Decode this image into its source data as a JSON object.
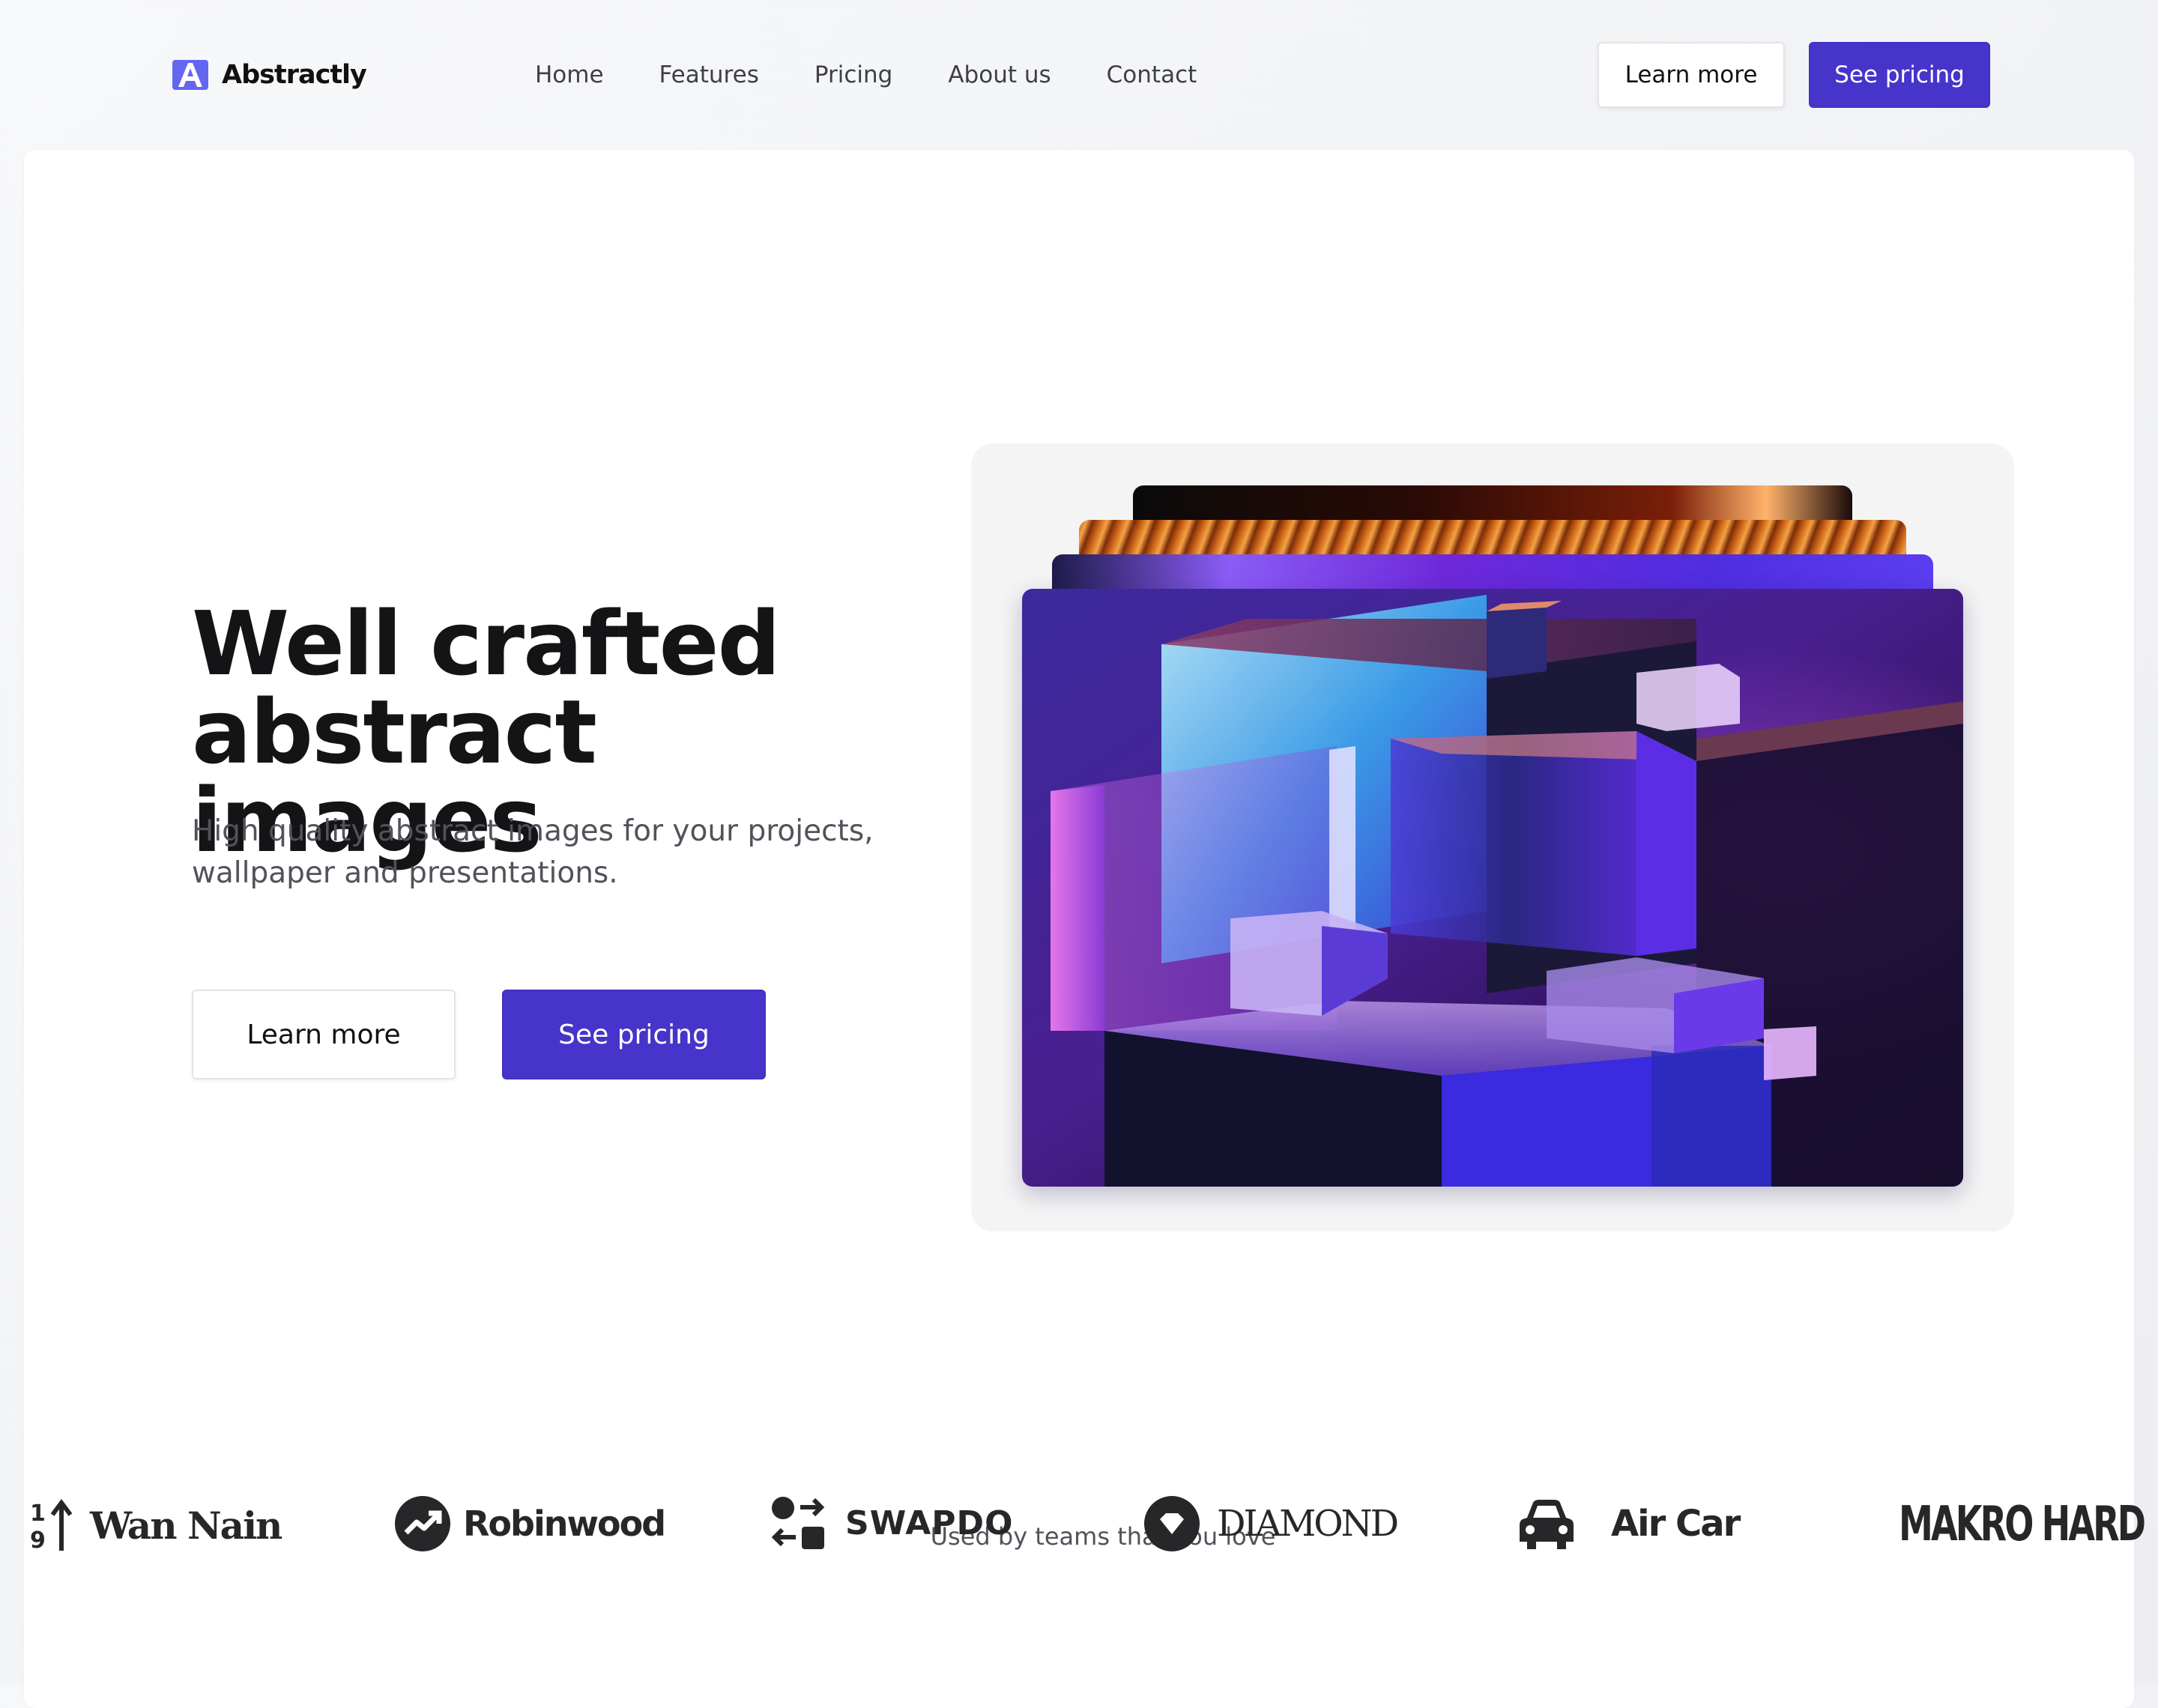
{
  "brand": {
    "name": "Abstractly",
    "color": "#6366f1"
  },
  "nav": {
    "items": [
      {
        "label": "Home"
      },
      {
        "label": "Features"
      },
      {
        "label": "Pricing"
      },
      {
        "label": "About us"
      },
      {
        "label": "Contact"
      }
    ]
  },
  "header": {
    "learn_label": "Learn more",
    "pricing_label": "See pricing"
  },
  "hero": {
    "title_line1": "Well crafted",
    "title_line2": "abstract images",
    "subtitle_line1": "High quality abstract images for your projects,",
    "subtitle_line2": "wallpaper and presentations.",
    "learn_label": "Learn more",
    "pricing_label": "See pricing"
  },
  "colors": {
    "primary": "#4634cb",
    "text": "#141416",
    "muted": "#52525b"
  },
  "logos": {
    "caption": "Used by teams that you love",
    "items": [
      {
        "name": "Wan Nain",
        "icon": "arrow-up-19-icon"
      },
      {
        "name": "Robinwood",
        "icon": "trending-up-circle-icon"
      },
      {
        "name": "SWAPDO",
        "icon": "swap-shapes-icon"
      },
      {
        "name": "DIAMOND",
        "icon": "diamond-circle-icon"
      },
      {
        "name": "Air Car",
        "icon": "car-icon"
      },
      {
        "name": "MAKRO HARD",
        "icon": ""
      }
    ]
  }
}
